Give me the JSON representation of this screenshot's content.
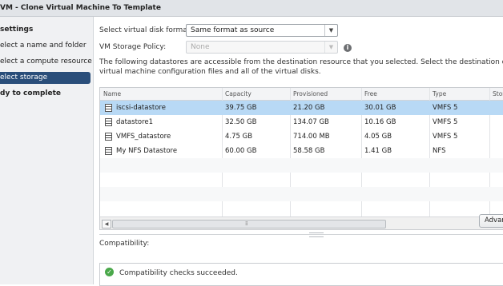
{
  "window": {
    "title": "VM - Clone Virtual Machine To Template"
  },
  "sidebar": {
    "items": [
      {
        "label": "settings"
      },
      {
        "label": "elect a name and folder"
      },
      {
        "label": "elect a compute resource"
      },
      {
        "label": "elect storage",
        "selected": true
      },
      {
        "label": "dy to complete"
      }
    ]
  },
  "form": {
    "disk_format_label": "Select virtual disk format:",
    "disk_format_value": "Same format as source",
    "storage_policy_label": "VM Storage Policy:",
    "storage_policy_value": "None",
    "description_line1": "The following datastores are accessible from the destination resource that you selected. Select the destination datastore f",
    "description_line2": "virtual machine configuration files and all of the virtual disks."
  },
  "table": {
    "columns": [
      "Name",
      "Capacity",
      "Provisioned",
      "Free",
      "Type",
      "Stor"
    ],
    "rows": [
      {
        "name": "iscsi-datastore",
        "capacity": "39.75 GB",
        "provisioned": "21.20 GB",
        "free": "30.01 GB",
        "type": "VMFS 5",
        "selected": true
      },
      {
        "name": "datastore1",
        "capacity": "32.50 GB",
        "provisioned": "134.07 GB",
        "free": "10.16 GB",
        "type": "VMFS 5"
      },
      {
        "name": "VMFS_datastore",
        "capacity": "4.75 GB",
        "provisioned": "714.00 MB",
        "free": "4.05 GB",
        "type": "VMFS 5"
      },
      {
        "name": "My NFS Datastore",
        "capacity": "60.00 GB",
        "provisioned": "58.58 GB",
        "free": "1.41 GB",
        "type": "NFS"
      }
    ]
  },
  "advanced_button": "Advan",
  "compatibility": {
    "label": "Compatibility:",
    "message": "Compatibility checks succeeded."
  },
  "colors": {
    "selection": "#b8d9f5",
    "sidebar_selected": "#2a4e7a",
    "success": "#4aa84a"
  }
}
